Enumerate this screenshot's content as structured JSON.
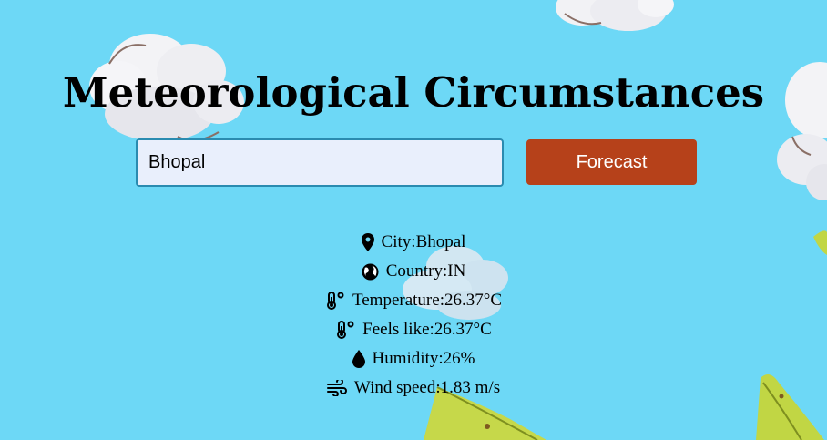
{
  "header": {
    "title": "Meteorological Circumstances"
  },
  "search": {
    "value": "Bhopal",
    "button_label": "Forecast"
  },
  "weather": {
    "rows": [
      {
        "icon": "map-pin-icon",
        "label": "City:",
        "value": "Bhopal"
      },
      {
        "icon": "globe-icon",
        "label": "Country:",
        "value": "IN"
      },
      {
        "icon": "thermometer-icon",
        "label": "Temperature:",
        "value": "26.37°C"
      },
      {
        "icon": "thermometer-icon",
        "label": "Feels like:",
        "value": "26.37°C"
      },
      {
        "icon": "water-drop-icon",
        "label": "Humidity:",
        "value": "26%"
      },
      {
        "icon": "wind-icon",
        "label": "Wind speed:",
        "value": "1.83 m/s"
      }
    ]
  },
  "colors": {
    "background": "#6dd8f6",
    "button": "#b6411a",
    "input_background": "#e9effc",
    "input_border": "#2a8bb0"
  }
}
